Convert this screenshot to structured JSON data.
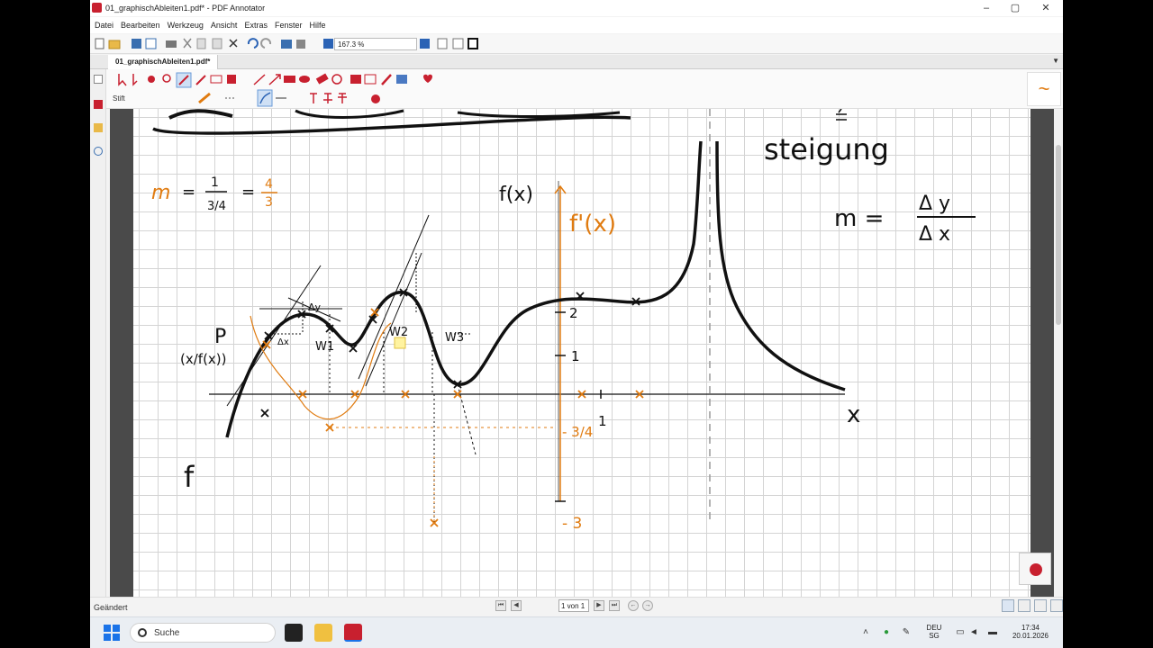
{
  "window": {
    "title": "01_graphischAbleiten1.pdf* - PDF Annotator",
    "minimize": "–",
    "maximize": "▢",
    "close": "✕"
  },
  "menu": [
    "Datei",
    "Bearbeiten",
    "Werkzeug",
    "Ansicht",
    "Extras",
    "Fenster",
    "Hilfe"
  ],
  "toolbar": {
    "zoom": "167.3 %"
  },
  "tabs": [
    {
      "label": "01_graphischAbleiten1.pdf*"
    }
  ],
  "tool_label": "Stift",
  "status": {
    "text": "Geändert",
    "page_indicator": "1 von 1"
  },
  "taskbar": {
    "search_placeholder": "Suche",
    "language": "DEU",
    "region": "SG",
    "time": "17:34",
    "date": "20.01.2026"
  },
  "handwriting": {
    "steigung": "steigung",
    "m_formula_m": "m =",
    "delta_y": "Δ y",
    "delta_x": "Δ x",
    "f_of_x": "f(x)",
    "f_prime": "f'(x)",
    "x_axis": "x",
    "f_label": "f",
    "point_label": "P",
    "point_coords": "(x/f(x))",
    "orange_m": "m",
    "eq": "=",
    "one": "1",
    "three_quarter": "3/4",
    "eq2": "=",
    "four": "4",
    "three": "3",
    "w1": "W1",
    "w2": "W2",
    "w3": "W3",
    "tick_2": "2",
    "tick_1": "1",
    "tick_x1": "1",
    "minus_3_4": "- 3/4",
    "minus_3": "- 3",
    "small_dy": "Δy",
    "small_dx": "Δx"
  },
  "colors": {
    "ink": "#111111",
    "orange": "#e07b10",
    "accent_red": "#c8202f"
  }
}
